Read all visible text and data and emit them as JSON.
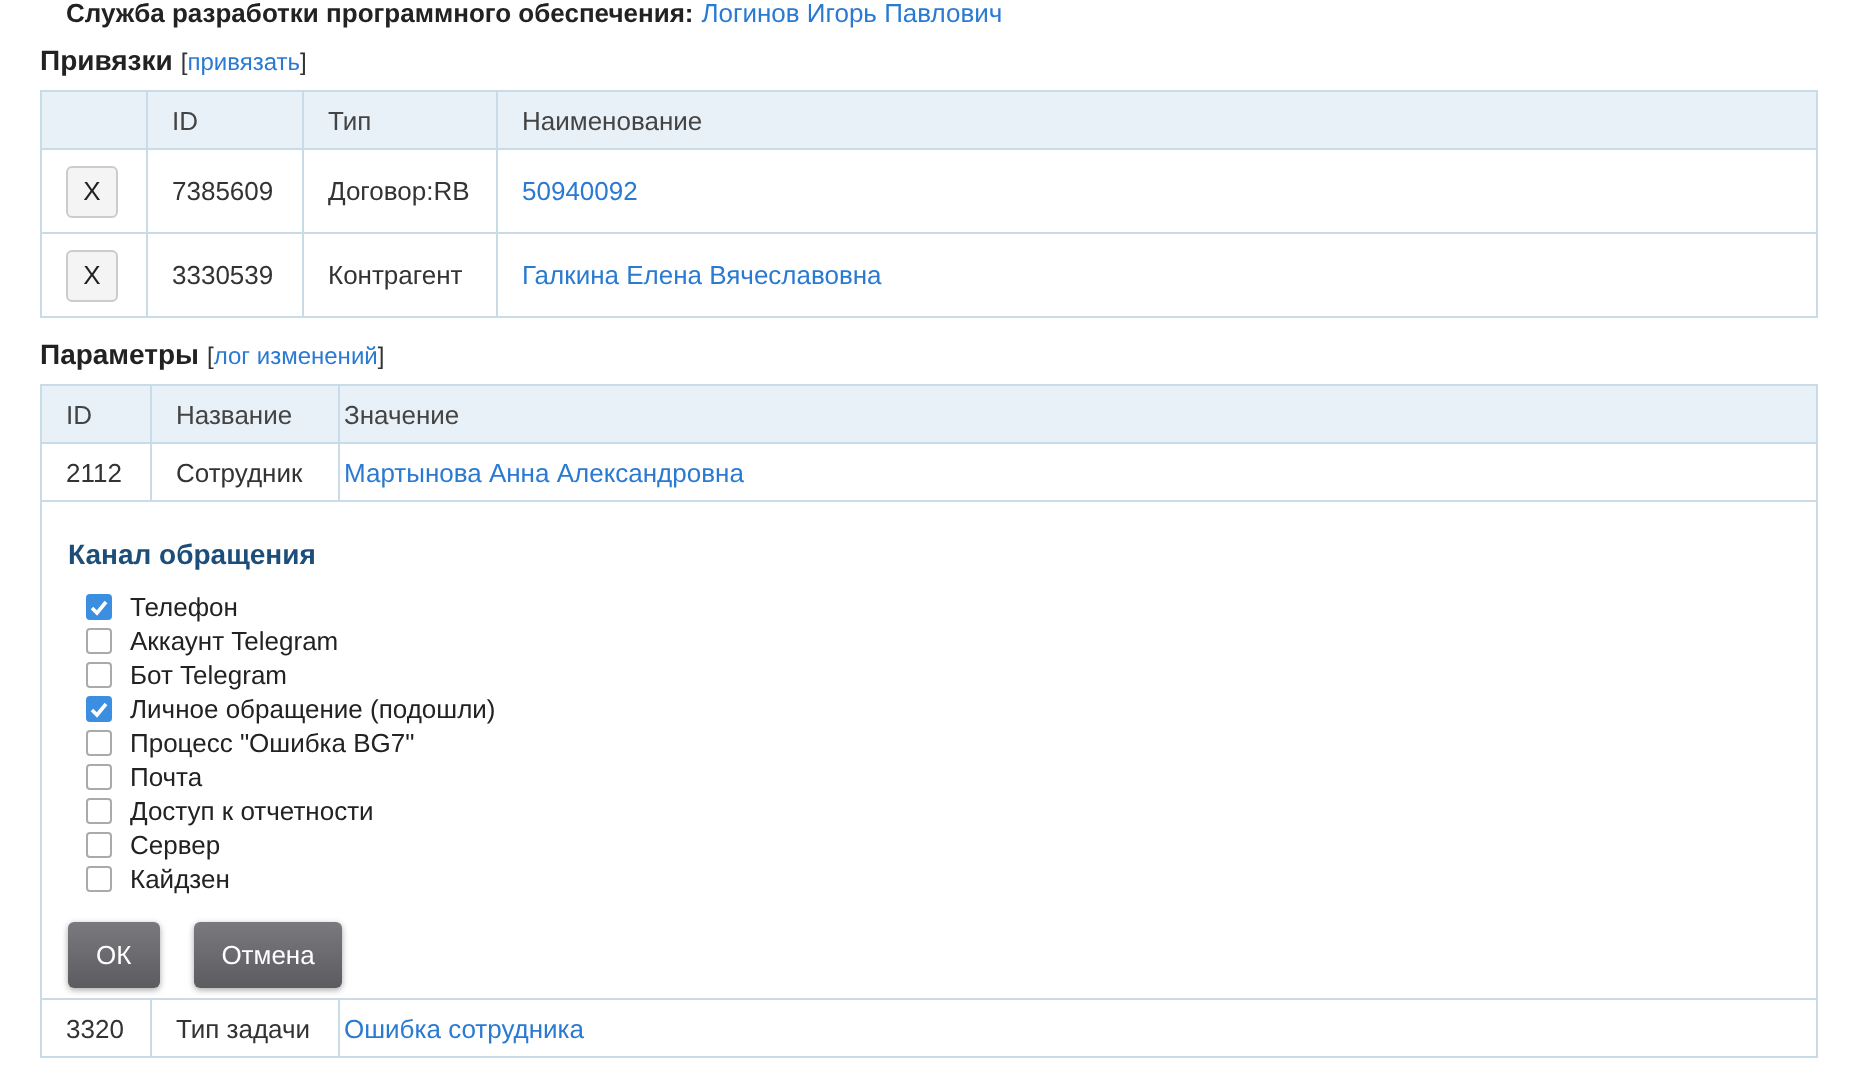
{
  "owner": {
    "label": "Служба разработки программного обеспечения:",
    "name": "Логинов Игорь Павлович"
  },
  "links_section": {
    "title": "Привязки",
    "bracket_open": "[",
    "action": "привязать",
    "bracket_close": "]",
    "columns": [
      "ID",
      "Тип",
      "Наименование"
    ],
    "rows": [
      {
        "remove": "X",
        "id": "7385609",
        "type": "Договор:RB",
        "name": "50940092"
      },
      {
        "remove": "X",
        "id": "3330539",
        "type": "Контрагент",
        "name": "Галкина Елена Вячеславовна"
      }
    ]
  },
  "params_section": {
    "title": "Параметры",
    "bracket_open": "[",
    "action": "лог изменений",
    "bracket_close": "]",
    "columns": [
      "ID",
      "Название",
      "Значение"
    ],
    "rows": [
      {
        "kind": "value",
        "id": "2112",
        "name": "Сотрудник",
        "value": "Мартынова Анна Александровна"
      },
      {
        "kind": "editor",
        "title": "Канал обращения",
        "options": [
          {
            "label": "Телефон",
            "checked": true
          },
          {
            "label": "Аккаунт Telegram",
            "checked": false
          },
          {
            "label": "Бот Telegram",
            "checked": false
          },
          {
            "label": "Личное обращение (подошли)",
            "checked": true
          },
          {
            "label": "Процесс \"Ошибка BG7\"",
            "checked": false
          },
          {
            "label": "Почта",
            "checked": false
          },
          {
            "label": "Доступ к отчетности",
            "checked": false
          },
          {
            "label": "Сервер",
            "checked": false
          },
          {
            "label": "Кайдзен",
            "checked": false
          }
        ],
        "buttons": [
          "ОК",
          "Отмена"
        ]
      },
      {
        "kind": "value",
        "id": "3320",
        "name": "Тип задачи",
        "value": "Ошибка сотрудника"
      }
    ]
  }
}
